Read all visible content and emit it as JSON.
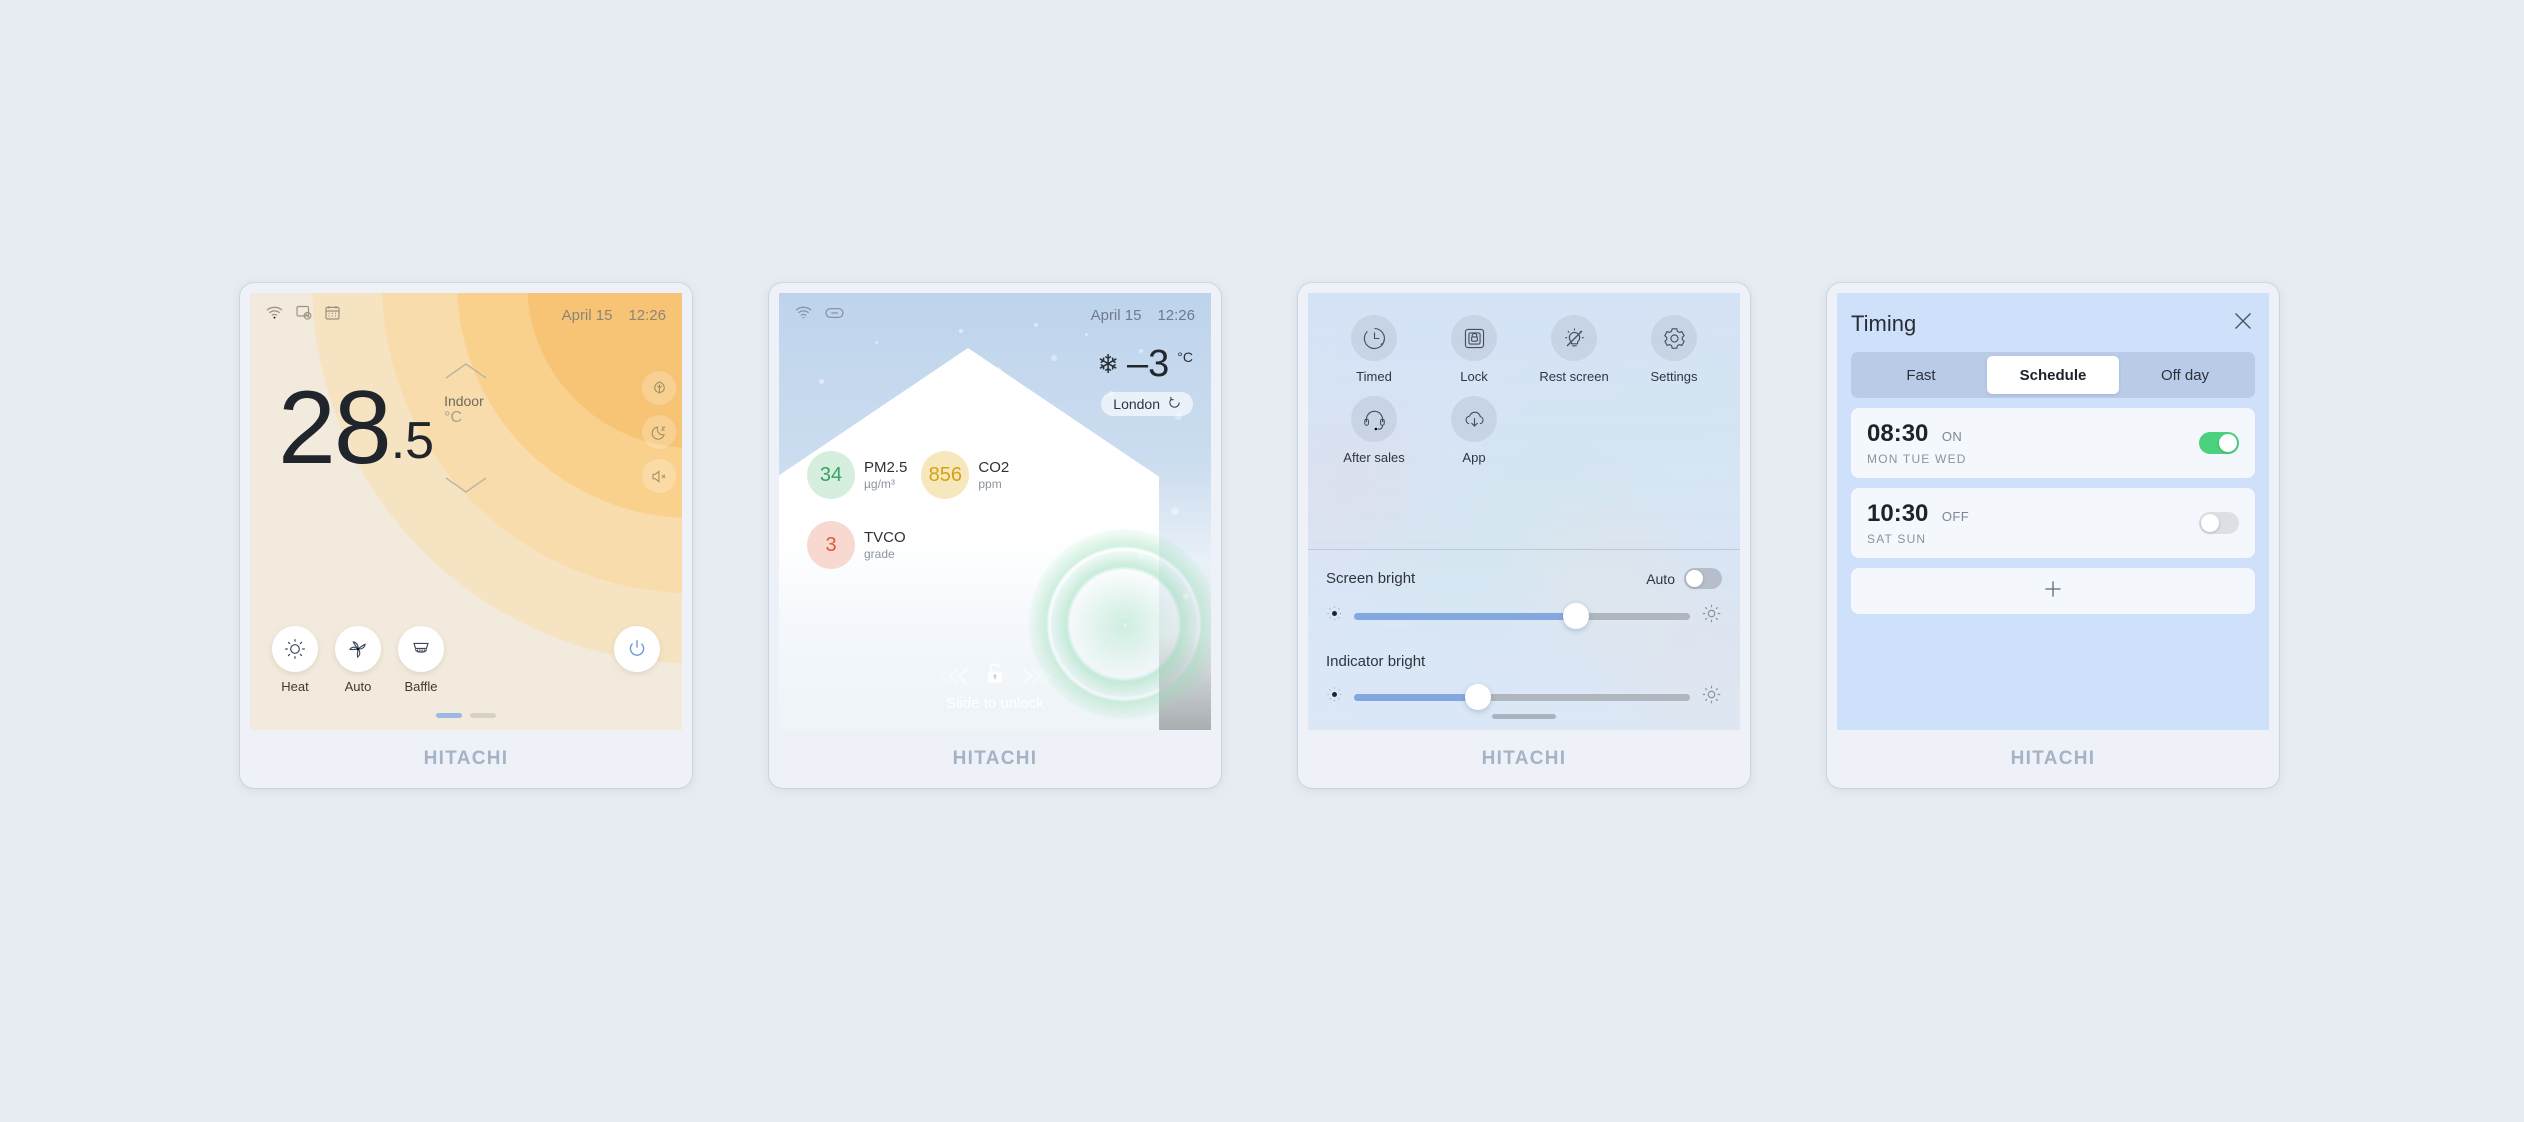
{
  "brand": "HITACHI",
  "panels": {
    "thermostat": {
      "statusbar": {
        "icons": [
          "wifi-icon",
          "no-display-icon",
          "calendar-icon"
        ],
        "date": "April 15",
        "time": "12:26"
      },
      "temperature_int": "28",
      "temperature_dec": ".5",
      "temperature_label": "Indoor",
      "temperature_unit": "°C",
      "side_icons": [
        "eco-leaf-icon",
        "sleep-moon-icon",
        "mute-speaker-icon"
      ],
      "modes": [
        {
          "label": "Heat",
          "icon": "sun-icon"
        },
        {
          "label": "Auto",
          "icon": "fan-icon"
        },
        {
          "label": "Baffle",
          "icon": "louver-icon"
        }
      ],
      "power_icon": "power-icon",
      "pagination": {
        "pages": 2,
        "active": 0
      }
    },
    "lockscreen": {
      "statusbar": {
        "icons": [
          "wifi-icon",
          "link-icon"
        ],
        "date": "April 15",
        "time": "12:26"
      },
      "weather": {
        "icon": "snowflake-icon",
        "temperature": "–3",
        "unit": "°C",
        "city": "London",
        "refresh_icon": "refresh-icon"
      },
      "air_quality": [
        {
          "value": "34",
          "name": "PM2.5",
          "unit": "µg/m³",
          "bubble": "#d5eedd",
          "color": "#34a465"
        },
        {
          "value": "856",
          "name": "CO2",
          "unit": "ppm",
          "bubble": "#f6e7bd",
          "color": "#d6a215"
        },
        {
          "value": "3",
          "name": "TVCO",
          "unit": "grade",
          "bubble": "#f7d9d1",
          "color": "#e2573a"
        }
      ],
      "unlock_text": "Slide to unlock",
      "unlock_icon": "unlock-icon"
    },
    "control_center": {
      "tiles": [
        {
          "label": "Timed",
          "icon": "clock-timer-icon"
        },
        {
          "label": "Lock",
          "icon": "lock-square-icon"
        },
        {
          "label": "Rest screen",
          "icon": "bulb-off-icon"
        },
        {
          "label": "Settings",
          "icon": "gear-icon"
        },
        {
          "label": "After sales",
          "icon": "headset-icon"
        },
        {
          "label": "App",
          "icon": "cloud-download-icon"
        }
      ],
      "screen_bright": {
        "label": "Screen bright",
        "auto_label": "Auto",
        "auto_on": false,
        "value": 66,
        "low_icon": "brightness-low-icon",
        "high_icon": "brightness-high-icon"
      },
      "indicator_bright": {
        "label": "Indicator bright",
        "value": 37,
        "low_icon": "brightness-low-icon",
        "high_icon": "brightness-high-icon"
      },
      "home_indicator": "home-bar"
    },
    "timing": {
      "title": "Timing",
      "close_icon": "close-icon",
      "tabs": [
        {
          "label": "Fast",
          "active": false
        },
        {
          "label": "Schedule",
          "active": true
        },
        {
          "label": "Off day",
          "active": false
        }
      ],
      "schedules": [
        {
          "time": "08:30",
          "state": "ON",
          "days": "MON TUE WED",
          "enabled": true
        },
        {
          "time": "10:30",
          "state": "OFF",
          "days": "SAT SUN",
          "enabled": false
        }
      ],
      "add_icon": "plus-icon"
    }
  },
  "colors": {
    "page_bg": "#e7ecf2",
    "accent_blue": "#83a8e0",
    "toggle_green": "#4cd27e",
    "brand_gray": "#a6b2c6",
    "warm_bg": "#f2ebdd"
  }
}
